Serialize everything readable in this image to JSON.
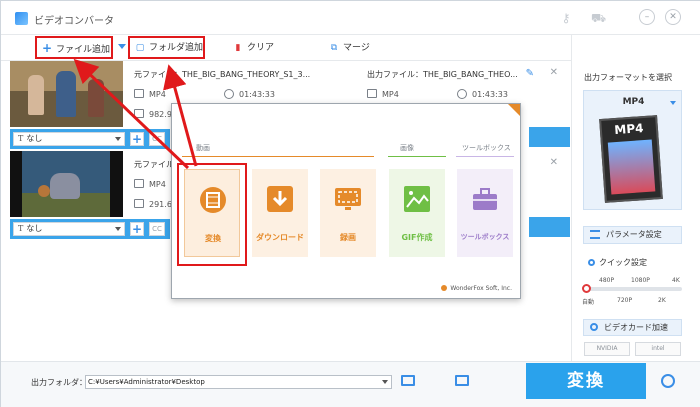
{
  "app": {
    "title": "ビデオコンバータ"
  },
  "toolbar": {
    "add_files": "ファイル追加",
    "add_folder": "フォルダ追加",
    "clear": "クリア",
    "merge": "マージ"
  },
  "files": [
    {
      "source_label": "元ファイル：THE_BIG_BANG_THEORY_S1_3...",
      "output_label": "出力ファイル：THE_BIG_BANG_THEO...",
      "source_format": "MP4",
      "source_duration": "01:43:33",
      "output_format": "MP4",
      "output_duration": "01:43:33",
      "size": "982.9",
      "subtitle": "なし"
    },
    {
      "source_label": "元ファイル",
      "source_format": "MP4",
      "size": "291.6",
      "subtitle": "なし"
    }
  ],
  "right_panel": {
    "title": "出力フォーマットを選択",
    "format": "MP4",
    "format_icon_label": "MP4",
    "param_button": "パラメータ設定",
    "quick_title": "クイック設定",
    "quick_top": [
      "480P",
      "1080P",
      "4K"
    ],
    "quick_bottom": [
      "自動",
      "720P",
      "2K"
    ],
    "quick_level": 0,
    "gpu_button": "ビデオカード加速",
    "vendors": [
      "NVIDIA",
      "intel"
    ]
  },
  "bottom": {
    "out_folder_label": "出力フォルダ：",
    "out_path": "C:¥Users¥Administrator¥Desktop",
    "convert": "変換"
  },
  "popup": {
    "sections": [
      "動画",
      "画像",
      "ツールボックス"
    ],
    "tiles": [
      "変換",
      "ダウンロード",
      "録画",
      "GIF作成",
      "ツールボックス"
    ],
    "brand": "WonderFox Soft, Inc."
  },
  "colors": {
    "accent": "#2aa2ec",
    "orange": "#e58a2a",
    "green": "#6fbf45",
    "purple": "#9c7bc9",
    "annotation_red": "#e0191b"
  }
}
